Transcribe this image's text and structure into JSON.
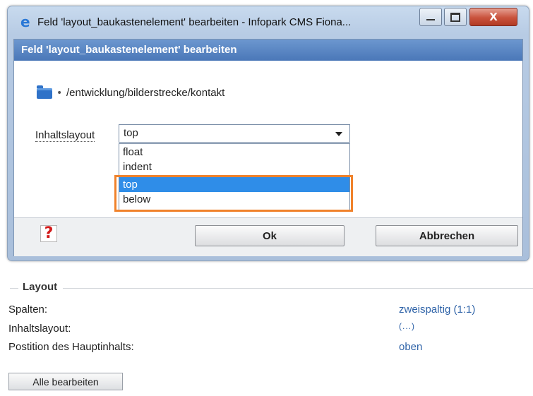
{
  "window": {
    "title": "Feld 'layout_baukastenelement' bearbeiten - Infopark CMS Fiona...",
    "close_glyph": "X",
    "icon": "ie-icon"
  },
  "dialog": {
    "header": "Feld 'layout_baukastenelement' bearbeiten",
    "path": "/entwicklung/bilderstrecke/kontakt",
    "field_label": "Inhaltslayout",
    "select_value": "top",
    "options": [
      "float",
      "indent",
      "top",
      "below"
    ],
    "selected_option": "top",
    "ok_label": "Ok",
    "cancel_label": "Abbrechen",
    "help_glyph": "?",
    "highlight_color": "#f0822b"
  },
  "layout_section": {
    "title": "Layout",
    "rows": [
      {
        "label": "Spalten:",
        "value": "zweispaltig (1:1)"
      },
      {
        "label": "Inhaltslayout:",
        "value": "(...)"
      },
      {
        "label": "Postition des Hauptinhalts:",
        "value": "oben"
      }
    ],
    "edit_all_label": "Alle bearbeiten"
  }
}
